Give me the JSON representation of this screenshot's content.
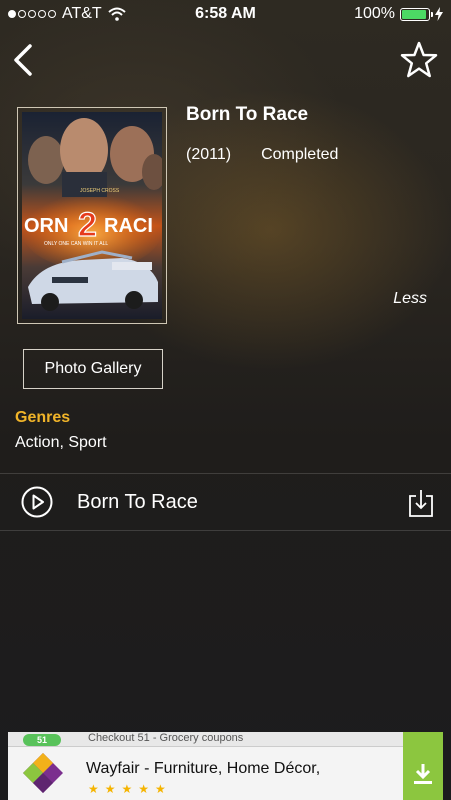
{
  "status_bar": {
    "carrier": "AT&T",
    "time": "6:58 AM",
    "battery_percent": "100%",
    "signal_bars_filled": 1,
    "signal_bars_total": 5,
    "battery_fill": 1.0,
    "battery_color": "#4cd964"
  },
  "nav": {
    "back_icon": "chevron-left-icon",
    "favorite_icon": "star-outline-icon"
  },
  "movie": {
    "title": "Born To Race",
    "year": "(2011)",
    "status": "Completed",
    "less_label": "Less",
    "poster": {
      "top_credit": "JOSEPH CROSS",
      "headline_left": "ORN",
      "headline_number": "2",
      "headline_right": "RACI",
      "tagline": "ONLY ONE CAN WIN IT ALL"
    }
  },
  "gallery_button": {
    "label": "Photo Gallery"
  },
  "genres": {
    "label": "Genres",
    "value": "Action, Sport",
    "label_color": "#f0b429"
  },
  "episodes": [
    {
      "title": "Born To Race",
      "play_icon": "play-circle-icon",
      "download_icon": "download-icon"
    }
  ],
  "ad": {
    "top_badge": "51",
    "top_text": "Checkout 51 - Grocery coupons",
    "title": "Wayfair - Furniture, Home Décor,",
    "stars": "★★★★★",
    "download_color": "#8cc63f"
  }
}
